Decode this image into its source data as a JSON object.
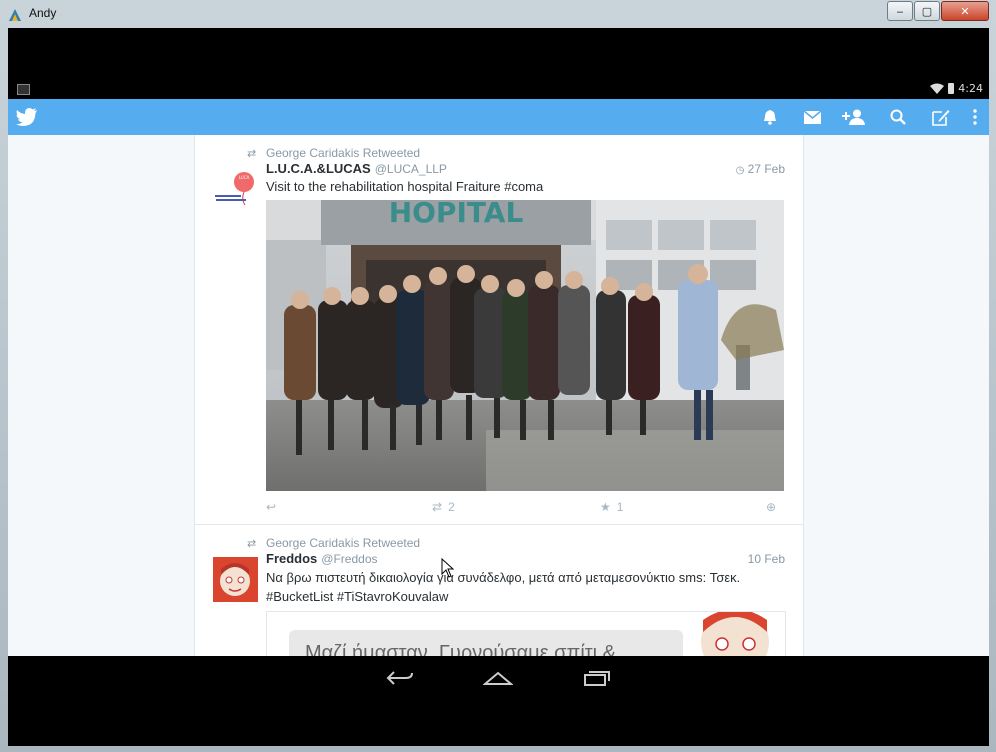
{
  "window": {
    "title": "Andy",
    "controls": {
      "minimize": "‒",
      "maximize": "▢",
      "close": "✕"
    }
  },
  "statusbar": {
    "time": "4:24"
  },
  "appbar": {
    "icons": [
      "twitter-bird-icon",
      "notifications-icon",
      "messages-icon",
      "add-user-icon",
      "search-icon",
      "compose-icon",
      "overflow-menu-icon"
    ],
    "accent": "#55acee"
  },
  "tweets": [
    {
      "retweeted_by": "George Caridakis Retweeted",
      "name": "L.U.C.A.&LUCAS",
      "handle": "@LUCA_LLP",
      "date": "27 Feb",
      "text": "Visit to the rehabilitation hospital Fraiture #coma",
      "media_sign": "HOPITAL",
      "retweets": "2",
      "favorites": "1"
    },
    {
      "retweeted_by": "George Caridakis Retweeted",
      "name": "Freddos",
      "handle": "@Freddos",
      "date": "10 Feb",
      "text": "Να βρω πιστευτή δικαιολογία για συνάδελφο, μετά από μεταμεσονύκτιο sms: Τσεκ. #BucketList #TiStavroKouvalaw",
      "media_caption": "Μαζί ήμασταν. Γυρνούσαμε σπίτι &"
    }
  ],
  "navbar": {
    "icons": [
      "back-icon",
      "home-icon",
      "recents-icon"
    ]
  }
}
